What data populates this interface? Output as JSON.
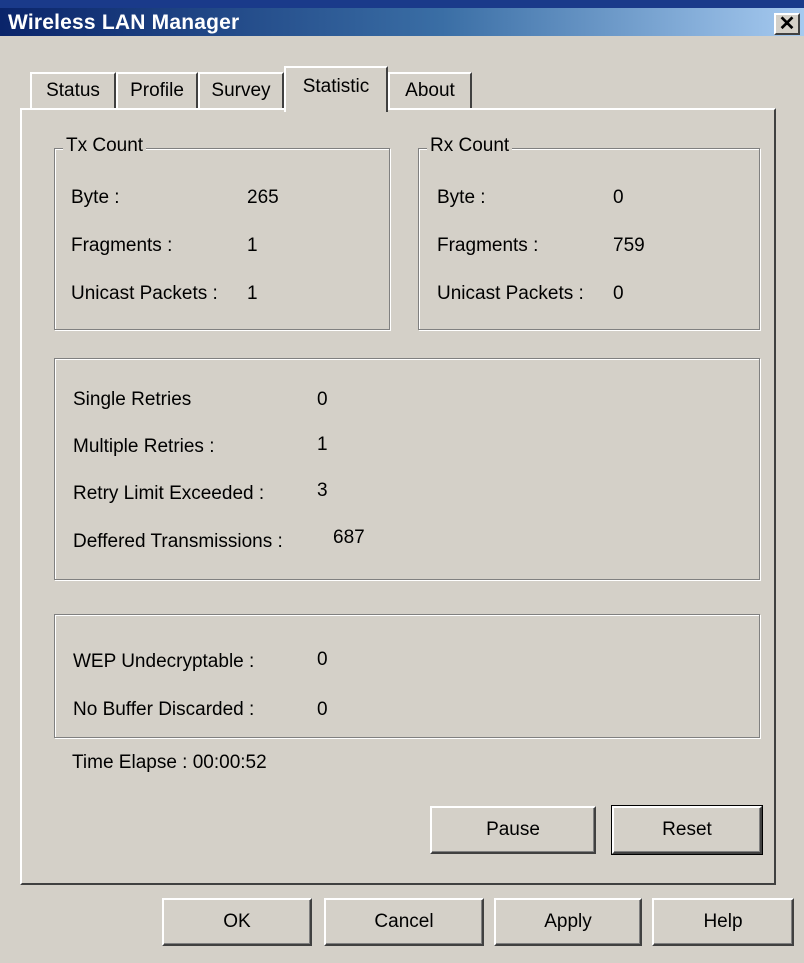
{
  "window": {
    "title": "Wireless LAN Manager",
    "close_glyph": "✕"
  },
  "tabs": [
    {
      "label": "Status"
    },
    {
      "label": "Profile"
    },
    {
      "label": "Survey"
    },
    {
      "label": "Statistic"
    },
    {
      "label": "About"
    }
  ],
  "active_tab": "Statistic",
  "tx": {
    "title": "Tx Count",
    "byte_label": "Byte :",
    "byte_value": "265",
    "fragments_label": "Fragments :",
    "fragments_value": "1",
    "unicast_label": "Unicast Packets :",
    "unicast_value": "1"
  },
  "rx": {
    "title": "Rx Count",
    "byte_label": "Byte :",
    "byte_value": "0",
    "fragments_label": "Fragments :",
    "fragments_value": "759",
    "unicast_label": "Unicast Packets :",
    "unicast_value": "0"
  },
  "retries": {
    "single_label": "Single Retries",
    "single_value": "0",
    "multiple_label": "Multiple Retries :",
    "multiple_value": "1",
    "limit_label": "Retry Limit Exceeded :",
    "limit_value": "3",
    "deferred_label": "Deffered Transmissions :",
    "deferred_value": "687"
  },
  "errors": {
    "wep_label": "WEP Undecryptable :",
    "wep_value": "0",
    "nobuf_label": "No Buffer Discarded :",
    "nobuf_value": "0"
  },
  "time_elapse": "Time Elapse : 00:00:52",
  "buttons": {
    "pause": "Pause",
    "reset": "Reset",
    "ok": "OK",
    "cancel": "Cancel",
    "apply": "Apply",
    "help": "Help"
  }
}
